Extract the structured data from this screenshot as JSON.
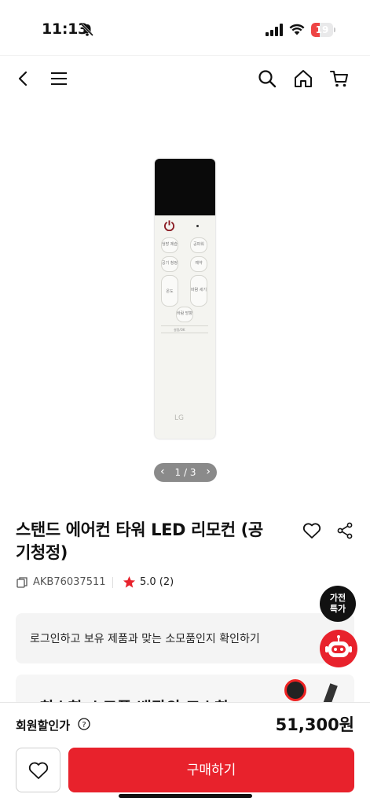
{
  "status_bar": {
    "time": "11:13",
    "battery": "19",
    "battery_level": 0.19
  },
  "header": {
    "back_icon": "chevron-left-icon",
    "menu_icon": "hamburger-icon",
    "search_icon": "search-icon",
    "home_icon": "home-icon",
    "cart_icon": "cart-icon"
  },
  "gallery": {
    "pager": "1 / 3",
    "current": 1,
    "total": 3
  },
  "product": {
    "title": "스탠드 에어컨 타워 LED 리모컨 (공기청정)",
    "sku": "AKB76037511",
    "rating": "5.0 (2)"
  },
  "remote_labels": {
    "btn1": "냉방 제습",
    "btn2": "공파워",
    "btn3": "공기 청정",
    "btn4": "예약",
    "btn5": "온도",
    "btn6": "바람 세기",
    "btn7": "바람 방향",
    "bar": "설정/OK",
    "logo": "LG"
  },
  "login_banner": {
    "text": "로그인하고 보유 제품과 맞는 소모품인지 확인하기"
  },
  "promo_banner": {
    "text": "최소한 소모품 배관의 교소한"
  },
  "floating": {
    "deal_label": "가전 특가"
  },
  "bottom_bar": {
    "member_price_label": "회원할인가",
    "price": "51,300원",
    "buy_label": "구매하기"
  },
  "colors": {
    "accent": "#e8222c",
    "pager_bg": "#8a8a8a",
    "deal_bg": "#111111"
  }
}
